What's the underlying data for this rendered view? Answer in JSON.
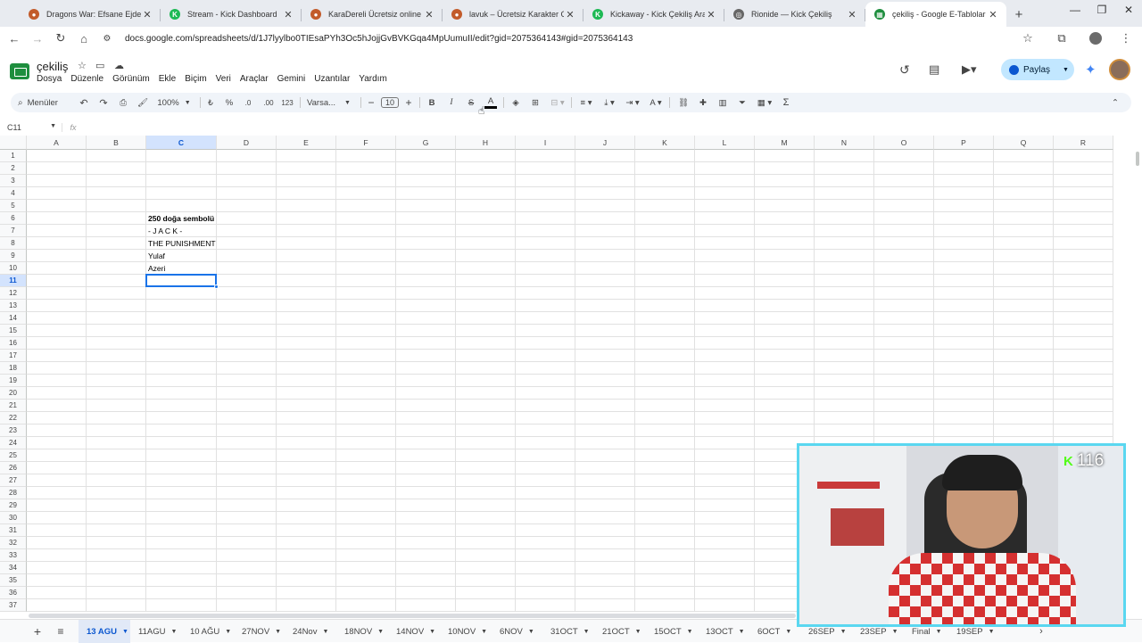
{
  "browser": {
    "tabs": [
      {
        "title": "Dragons War: Efsane Ejderhalar",
        "favicon_color": "#c25b2a",
        "favicon_glyph": "●",
        "active": false
      },
      {
        "title": "Stream - Kick Dashboard",
        "favicon_color": "#1db954",
        "favicon_glyph": "K",
        "active": false
      },
      {
        "title": "KaraDereli Ücretsiz online rol y",
        "favicon_color": "#c25b2a",
        "favicon_glyph": "●",
        "active": false
      },
      {
        "title": "lavuk – Ücretsiz Karakter Gelişt",
        "favicon_color": "#c25b2a",
        "favicon_glyph": "●",
        "active": false
      },
      {
        "title": "Kickaway - Kick Çekiliş Aracı",
        "favicon_color": "#1db954",
        "favicon_glyph": "K",
        "active": false
      },
      {
        "title": "Rionide — Kick Çekiliş",
        "favicon_color": "#666666",
        "favicon_glyph": "◎",
        "active": false
      },
      {
        "title": "çekiliş - Google E-Tablolar",
        "favicon_color": "#1e8e3e",
        "favicon_glyph": "▦",
        "active": true
      }
    ],
    "url": "docs.google.com/spreadsheets/d/1J7lyylbo0TIEsaPYh3Oc5hJojjGvBVKGqa4MpUumuII/edit?gid=2075364143#gid=2075364143"
  },
  "doc": {
    "title": "çekiliş",
    "menus": [
      "Dosya",
      "Düzenle",
      "Görünüm",
      "Ekle",
      "Biçim",
      "Veri",
      "Araçlar",
      "Gemini",
      "Uzantılar",
      "Yardım"
    ],
    "share_label": "Paylaş"
  },
  "toolbar": {
    "menus_label": "Menüler",
    "zoom": "100%",
    "currency": "₺",
    "percent": "%",
    "dec_dec": ".0",
    "dec_inc": ".00",
    "format_123": "123",
    "font": "Varsa...",
    "font_size": "10",
    "bold": "B",
    "italic": "I",
    "strike": "S",
    "text_color": "A",
    "sum": "Σ"
  },
  "formula_bar": {
    "cell_ref": "C11",
    "fx": "fx",
    "value": ""
  },
  "grid": {
    "columns": [
      "A",
      "B",
      "C",
      "D",
      "E",
      "F",
      "G",
      "H",
      "I",
      "J",
      "K",
      "L",
      "M",
      "N",
      "O",
      "P",
      "Q",
      "R"
    ],
    "selected_column": "C",
    "selected_row": "11",
    "rows": [
      "1",
      "2",
      "3",
      "4",
      "5",
      "6",
      "7",
      "8",
      "9",
      "10",
      "11",
      "12",
      "13",
      "14",
      "15",
      "16",
      "17",
      "18",
      "19",
      "20",
      "21",
      "22",
      "23",
      "24",
      "25",
      "26",
      "27",
      "28",
      "29",
      "30",
      "31",
      "32",
      "33",
      "34",
      "35",
      "36",
      "37"
    ],
    "cells": [
      {
        "ref": "C6",
        "text": "250 doğa sembolü",
        "bold": true
      },
      {
        "ref": "C7",
        "text": "- J A C K -",
        "bold": false
      },
      {
        "ref": "C8",
        "text": "THE PUNISHMENT",
        "bold": false
      },
      {
        "ref": "C9",
        "text": "Yulaf",
        "bold": false
      },
      {
        "ref": "C10",
        "text": "Azeri",
        "bold": false
      }
    ]
  },
  "sheets": {
    "add_label": "+",
    "list_label": "≡",
    "tabs": [
      {
        "label": "13 AGU",
        "active": true
      },
      {
        "label": "11AGU",
        "active": false
      },
      {
        "label": "10 AĞU",
        "active": false
      },
      {
        "label": "27NOV",
        "active": false
      },
      {
        "label": "24Nov",
        "active": false
      },
      {
        "label": "18NOV",
        "active": false
      },
      {
        "label": "14NOV",
        "active": false
      },
      {
        "label": "10NOV",
        "active": false
      },
      {
        "label": "6NOV",
        "active": false
      },
      {
        "label": "31OCT",
        "active": false
      },
      {
        "label": "21OCT",
        "active": false
      },
      {
        "label": "15OCT",
        "active": false
      },
      {
        "label": "13OCT",
        "active": false
      },
      {
        "label": "6OCT",
        "active": false
      },
      {
        "label": "26SEP",
        "active": false
      },
      {
        "label": "23SEP",
        "active": false
      },
      {
        "label": "Final",
        "active": false
      },
      {
        "label": "19SEP",
        "active": false
      }
    ]
  },
  "webcam": {
    "viewer_count": "116",
    "badge_letter": "K",
    "border_color": "#5ad7f0"
  }
}
